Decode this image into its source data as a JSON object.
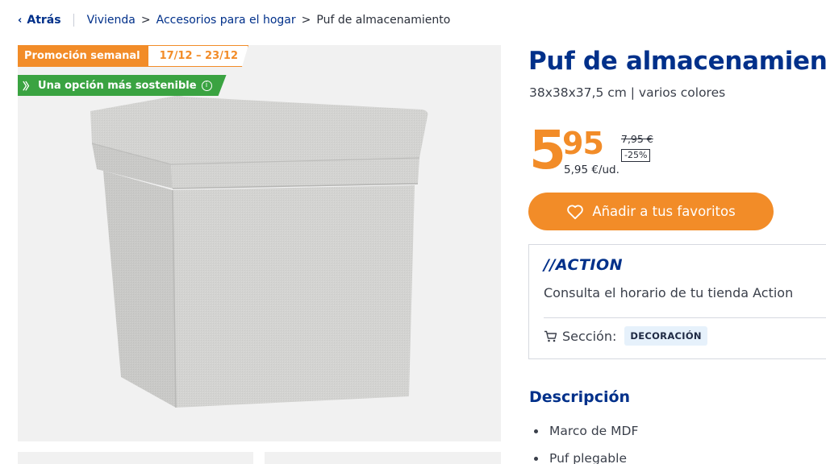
{
  "breadcrumb": {
    "back_label": "Atrás",
    "items": [
      "Vivienda",
      "Accesorios para el hogar"
    ],
    "current": "Puf de almacenamiento"
  },
  "gallery": {
    "promo_label": "Promoción semanal",
    "promo_dates": "17/12 – 23/12",
    "eco_label": "Una opción más sostenible"
  },
  "product": {
    "title": "Puf de almacenamiento",
    "subtitle": "38x38x37,5 cm | varios colores",
    "price_integer": "5",
    "price_decimal": "95",
    "price_unit": "5,95 €/ud.",
    "old_price": "7,95 €",
    "discount": "-25%",
    "favorite_label": "Añadir a tus favoritos"
  },
  "store": {
    "brand": "//ACTION",
    "info_text": "Consulta el horario de tu tienda Action",
    "section_label": "Sección:",
    "section_value": "DECORACIÓN"
  },
  "description": {
    "title": "Descripción",
    "items": [
      "Marco de MDF",
      "Puf plegable"
    ]
  },
  "colors": {
    "brand_blue": "#00308a",
    "accent_orange": "#f28c28",
    "eco_green": "#3aa341",
    "tag_bg": "#e6f1fb"
  },
  "icons": [
    "chevron-left-icon",
    "eco-chevrons-icon",
    "info-icon",
    "heart-icon",
    "cart-icon"
  ]
}
